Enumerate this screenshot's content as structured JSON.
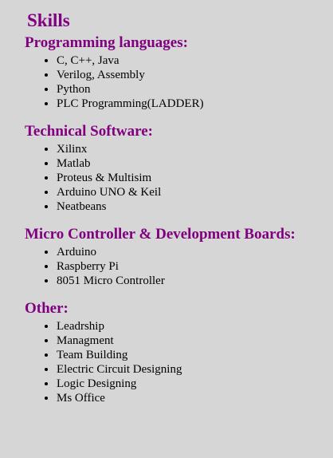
{
  "page": {
    "title": "Skills"
  },
  "sections": [
    {
      "heading": "Programming languages:",
      "items": [
        "C, C++, Java",
        "Verilog, Assembly",
        "Python",
        "PLC Programming(LADDER)"
      ]
    },
    {
      "heading": "Technical Software:",
      "items": [
        "Xilinx",
        "Matlab",
        "Proteus & Multisim",
        "Arduino UNO & Keil",
        "Neatbeans"
      ]
    },
    {
      "heading": "Micro Controller & Development Boards:",
      "items": [
        "Arduino",
        "Raspberry Pi",
        "8051 Micro Controller"
      ]
    },
    {
      "heading": "Other:",
      "items": [
        "Leadrship",
        "Managment",
        "Team Building",
        "Electric Circuit Designing",
        "Logic Designing",
        "Ms Office"
      ]
    }
  ],
  "colors": {
    "heading": "#800080",
    "background": "#d6d6d6",
    "text": "#000000"
  }
}
